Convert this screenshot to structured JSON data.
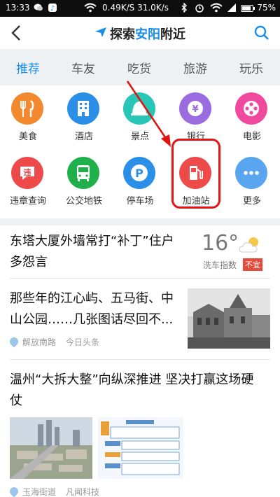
{
  "status_bar": {
    "time": "13:33",
    "net_speed": "0.49K/S",
    "net_speed_2": "31.0K/s",
    "battery": "75%"
  },
  "header": {
    "back_icon": "chevron-left-icon",
    "title_prefix": "探索",
    "title_city": "安阳",
    "title_suffix": "附近",
    "search_icon": "search-icon"
  },
  "tabs": [
    "推荐",
    "车友",
    "吃货",
    "旅游",
    "玩乐"
  ],
  "active_tab": 0,
  "grid": [
    {
      "label": "美食",
      "icon": "utensils-icon",
      "color": "#f2892e",
      "glyph": "🍴"
    },
    {
      "label": "酒店",
      "icon": "hotel-icon",
      "color": "#2b8fe8",
      "glyph": "▦"
    },
    {
      "label": "景点",
      "icon": "bell-landmark-icon",
      "color": "#27c6b6",
      "glyph": "▲"
    },
    {
      "label": "银行",
      "icon": "yuan-icon",
      "color": "#9b6be0",
      "glyph": "¥"
    },
    {
      "label": "电影",
      "icon": "film-reel-icon",
      "color": "#f04a9e",
      "glyph": "✿"
    },
    {
      "label": "违章查询",
      "icon": "violation-icon",
      "color": "#ef4a4a",
      "glyph": "违"
    },
    {
      "label": "公交地铁",
      "icon": "bus-icon",
      "color": "#20b04b",
      "glyph": "▣"
    },
    {
      "label": "停车场",
      "icon": "parking-icon",
      "color": "#2b8fe8",
      "glyph": "P"
    },
    {
      "label": "加油站",
      "icon": "gas-pump-icon",
      "color": "#ef4a4a",
      "glyph": "⛽"
    },
    {
      "label": "更多",
      "icon": "more-icon",
      "color": "#5aa5f0",
      "glyph": "•••"
    }
  ],
  "news": [
    {
      "title_line1": "东塔大厦外墙常打“补丁”住户",
      "title_line2": "多怨言"
    },
    {
      "title_line1": "那些年的江心屿、五马街、中",
      "title_line2": "山公园……几张图话尽回不...",
      "location": "解放南路",
      "source": "今日头条"
    },
    {
      "title_line1": "温州“大拆大整”向纵深推进 坚决打赢这场硬",
      "title_line2": "仗",
      "location": "玉海街道",
      "source": "凡闻科技"
    }
  ],
  "weather": {
    "temp": "16°",
    "wash_label": "洗车指数",
    "wash_badge": "不宜",
    "icon": "partly-cloudy-icon"
  }
}
